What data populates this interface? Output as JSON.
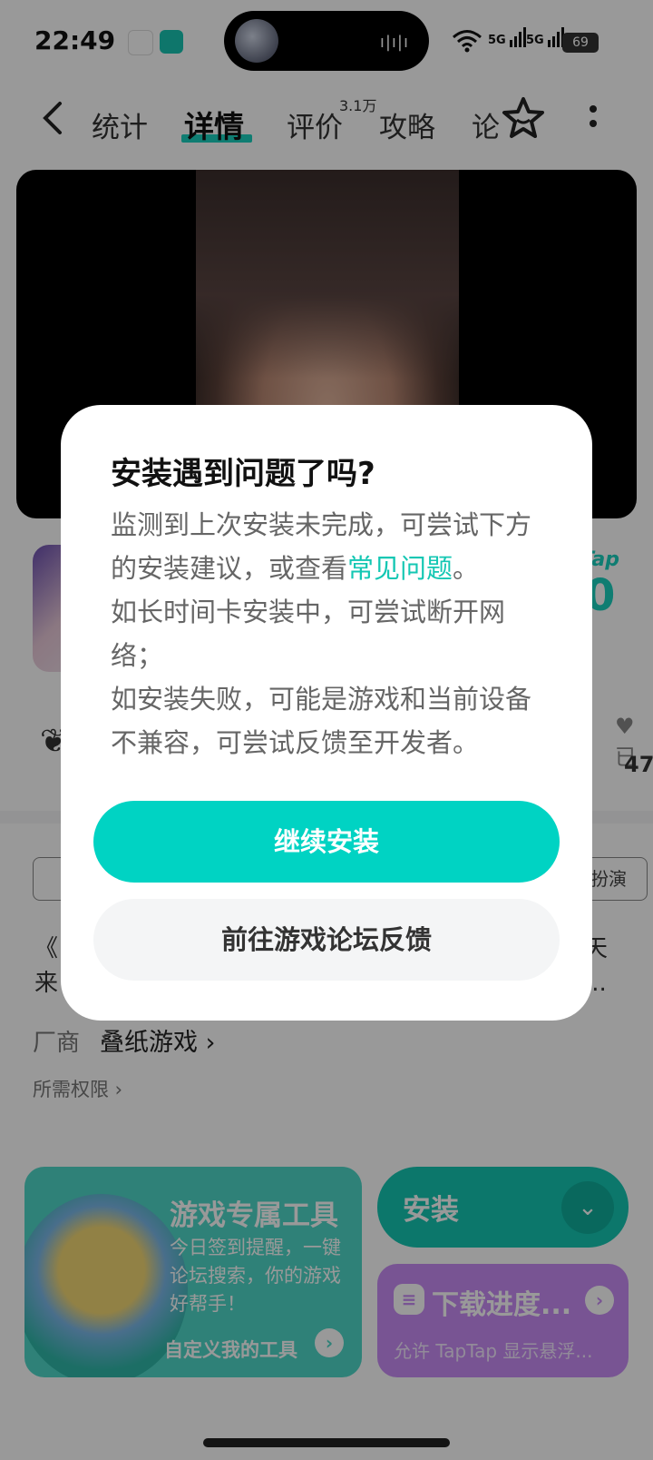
{
  "status_bar": {
    "time": "22:49",
    "signal1": "5G",
    "signal2": "5G",
    "battery": "69"
  },
  "nav": {
    "tabs": {
      "stats": "统计",
      "detail": "详情",
      "review": "评价",
      "review_count": "3.1万",
      "guide": "攻略",
      "forum": "论"
    }
  },
  "game": {
    "tap_label": "Tap",
    "score": "0",
    "fav_count": "47",
    "heart_label": "已",
    "tag_right": "扮演",
    "desc_left_1": "《",
    "desc_left_2": "来",
    "desc_right_1": "天",
    "desc_right_2": "...",
    "vendor_label": "厂商",
    "vendor_name": "叠纸游戏 ›",
    "permissions": "所需权限 ›"
  },
  "tools_card": {
    "title": "游戏专属工具",
    "desc": "今日签到提醒，一键论坛搜索，你的游戏好帮手！",
    "custom": "自定义我的工具"
  },
  "install_card": {
    "label": "安装"
  },
  "download_card": {
    "title": "下载进度...",
    "desc": "允许 TapTap 显示悬浮..."
  },
  "dialog": {
    "title": "安装遇到问题了吗?",
    "line1_pre": "监测到上次安装未完成，可尝试下方的安装建议，或查看",
    "faq_link": "常见问题",
    "line1_post": "。",
    "line2": "如长时间卡安装中，可尝试断开网络；",
    "line3": "如安装失败，可能是游戏和当前设备不兼容，可尝试反馈至开发者。",
    "continue_button": "继续安装",
    "forum_button": "前往游戏论坛反馈"
  },
  "colors": {
    "accent": "#00d3c3",
    "purple_card": "#c98cf5"
  }
}
